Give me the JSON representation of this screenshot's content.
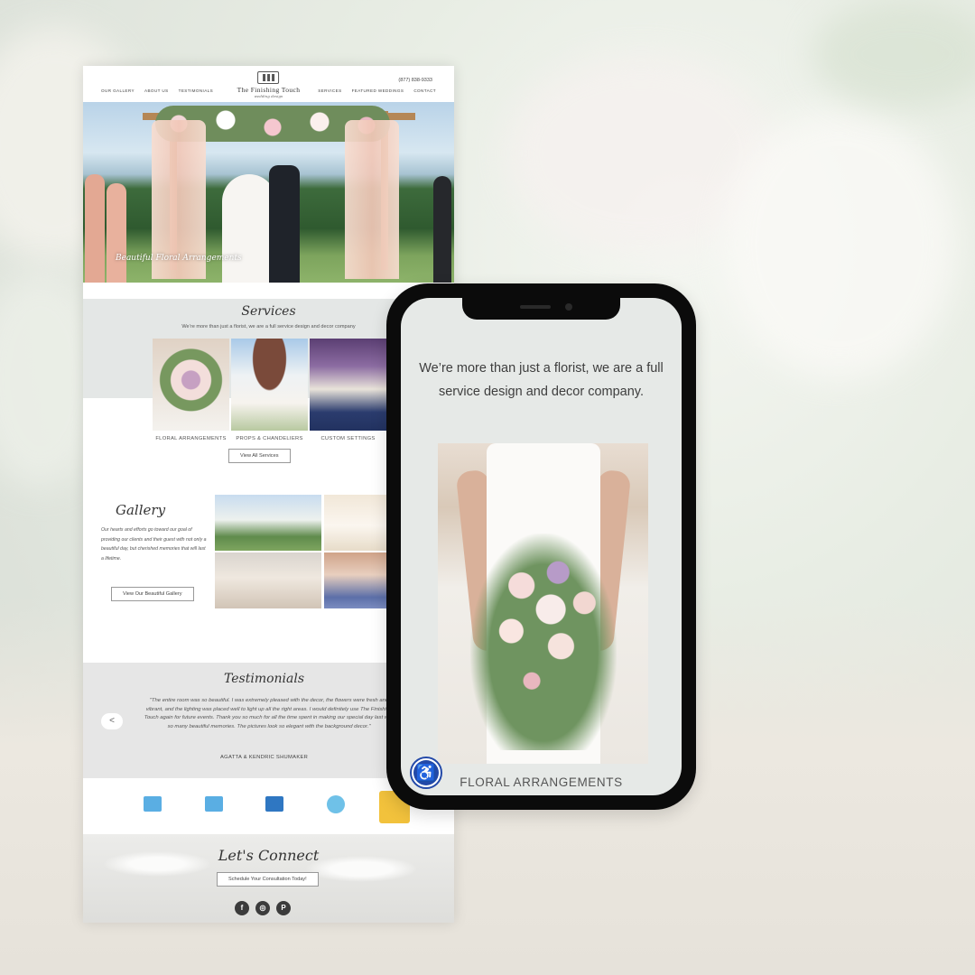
{
  "desktop": {
    "nav_left": [
      "OUR GALLERY",
      "ABOUT US",
      "TESTIMONIALS"
    ],
    "nav_right": [
      "SERVICES",
      "FEATURED WEDDINGS",
      "CONTACT"
    ],
    "phone": "(877) 838-9333",
    "logo_name": "The Finishing Touch",
    "logo_sub": "wedding design",
    "hero_caption": "Beautiful Floral Arrangements",
    "services": {
      "title": "Services",
      "tagline": "We’re more than just a florist, we are a full service design and decor company",
      "items": [
        "FLORAL ARRANGEMENTS",
        "PROPS & CHANDELIERS",
        "CUSTOM SETTINGS"
      ],
      "view_all": "View All Services"
    },
    "gallery": {
      "title": "Gallery",
      "description": "Our hearts and efforts go toward our goal of providing our clients and their guest with not only a beautiful day, but cherished memories that will last a lifetime.",
      "button": "View Our Beautiful Gallery"
    },
    "testimonials": {
      "title": "Testimonials",
      "quote": "\"The entire room was so beautiful. I was extremely pleased with the decor, the flowers were fresh and vibrant, and the lighting was placed well to light up all the right areas. I would definitely use The Finishing Touch again for future events. Thank you so much for all the time spent in making our special day last with so many beautiful memories. The pictures look so elegant with the background decor.\"",
      "author": "AGATTA & KENDRIC SHUMAKER",
      "prev": "<"
    },
    "connect": {
      "title": "Let's Connect",
      "button": "Schedule Your Consultation Today!",
      "socials": [
        "f",
        "◎",
        "P"
      ]
    }
  },
  "mobile": {
    "tagline": "We’re more than just a florist, we are a full service design and decor company.",
    "label": "FLORAL ARRANGEMENTS",
    "a11y": "♿"
  }
}
